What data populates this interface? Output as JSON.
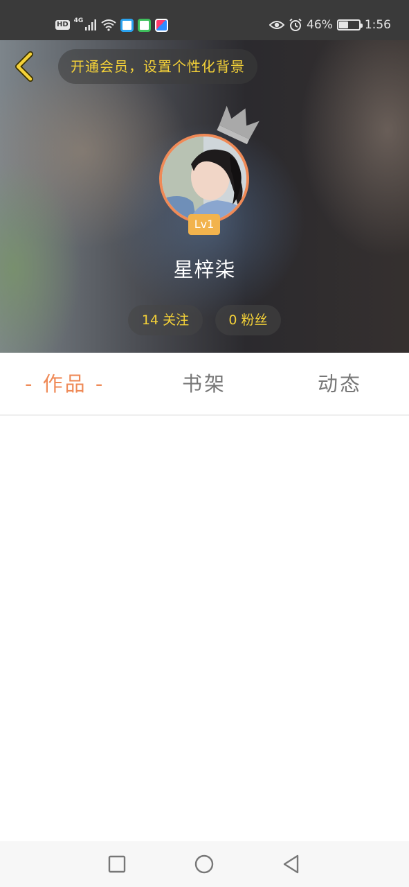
{
  "status_bar": {
    "hd": "HD",
    "network": "4G",
    "battery": "46%",
    "battery_level": 0.46,
    "time": "1:56",
    "icons": [
      "hd-icon",
      "signal-icon",
      "wifi-icon",
      "app-notification-icon",
      "eye-icon",
      "alarm-icon",
      "battery-icon"
    ]
  },
  "header": {
    "vip_prompt": "开通会员，设置个性化背景",
    "level": "Lv1",
    "username": "星梓柒",
    "following": "14 关注",
    "fans": "0 粉丝",
    "accent_color": "#f5d238"
  },
  "tabs": [
    {
      "label": "- 作品 -",
      "active": true
    },
    {
      "label": "书架",
      "active": false
    },
    {
      "label": "动态",
      "active": false
    }
  ],
  "colors": {
    "active_tab": "#ef8a57",
    "inactive_tab": "#777777",
    "avatar_ring": "#ef8a57",
    "level_badge": "#f2b34d"
  },
  "navbar": {
    "icons": [
      "recent-apps-icon",
      "home-icon",
      "back-icon"
    ]
  }
}
